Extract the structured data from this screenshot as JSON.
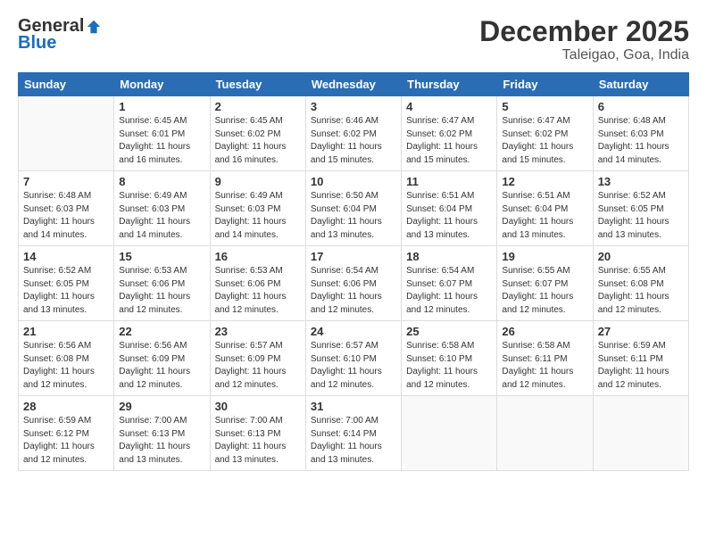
{
  "header": {
    "logo": {
      "general": "General",
      "blue": "Blue"
    },
    "title": "December 2025",
    "location": "Taleigao, Goa, India"
  },
  "weekdays": [
    "Sunday",
    "Monday",
    "Tuesday",
    "Wednesday",
    "Thursday",
    "Friday",
    "Saturday"
  ],
  "weeks": [
    [
      {
        "day": "",
        "info": ""
      },
      {
        "day": "1",
        "info": "Sunrise: 6:45 AM\nSunset: 6:01 PM\nDaylight: 11 hours\nand 16 minutes."
      },
      {
        "day": "2",
        "info": "Sunrise: 6:45 AM\nSunset: 6:02 PM\nDaylight: 11 hours\nand 16 minutes."
      },
      {
        "day": "3",
        "info": "Sunrise: 6:46 AM\nSunset: 6:02 PM\nDaylight: 11 hours\nand 15 minutes."
      },
      {
        "day": "4",
        "info": "Sunrise: 6:47 AM\nSunset: 6:02 PM\nDaylight: 11 hours\nand 15 minutes."
      },
      {
        "day": "5",
        "info": "Sunrise: 6:47 AM\nSunset: 6:02 PM\nDaylight: 11 hours\nand 15 minutes."
      },
      {
        "day": "6",
        "info": "Sunrise: 6:48 AM\nSunset: 6:03 PM\nDaylight: 11 hours\nand 14 minutes."
      }
    ],
    [
      {
        "day": "7",
        "info": "Sunrise: 6:48 AM\nSunset: 6:03 PM\nDaylight: 11 hours\nand 14 minutes."
      },
      {
        "day": "8",
        "info": "Sunrise: 6:49 AM\nSunset: 6:03 PM\nDaylight: 11 hours\nand 14 minutes."
      },
      {
        "day": "9",
        "info": "Sunrise: 6:49 AM\nSunset: 6:03 PM\nDaylight: 11 hours\nand 14 minutes."
      },
      {
        "day": "10",
        "info": "Sunrise: 6:50 AM\nSunset: 6:04 PM\nDaylight: 11 hours\nand 13 minutes."
      },
      {
        "day": "11",
        "info": "Sunrise: 6:51 AM\nSunset: 6:04 PM\nDaylight: 11 hours\nand 13 minutes."
      },
      {
        "day": "12",
        "info": "Sunrise: 6:51 AM\nSunset: 6:04 PM\nDaylight: 11 hours\nand 13 minutes."
      },
      {
        "day": "13",
        "info": "Sunrise: 6:52 AM\nSunset: 6:05 PM\nDaylight: 11 hours\nand 13 minutes."
      }
    ],
    [
      {
        "day": "14",
        "info": "Sunrise: 6:52 AM\nSunset: 6:05 PM\nDaylight: 11 hours\nand 13 minutes."
      },
      {
        "day": "15",
        "info": "Sunrise: 6:53 AM\nSunset: 6:06 PM\nDaylight: 11 hours\nand 12 minutes."
      },
      {
        "day": "16",
        "info": "Sunrise: 6:53 AM\nSunset: 6:06 PM\nDaylight: 11 hours\nand 12 minutes."
      },
      {
        "day": "17",
        "info": "Sunrise: 6:54 AM\nSunset: 6:06 PM\nDaylight: 11 hours\nand 12 minutes."
      },
      {
        "day": "18",
        "info": "Sunrise: 6:54 AM\nSunset: 6:07 PM\nDaylight: 11 hours\nand 12 minutes."
      },
      {
        "day": "19",
        "info": "Sunrise: 6:55 AM\nSunset: 6:07 PM\nDaylight: 11 hours\nand 12 minutes."
      },
      {
        "day": "20",
        "info": "Sunrise: 6:55 AM\nSunset: 6:08 PM\nDaylight: 11 hours\nand 12 minutes."
      }
    ],
    [
      {
        "day": "21",
        "info": "Sunrise: 6:56 AM\nSunset: 6:08 PM\nDaylight: 11 hours\nand 12 minutes."
      },
      {
        "day": "22",
        "info": "Sunrise: 6:56 AM\nSunset: 6:09 PM\nDaylight: 11 hours\nand 12 minutes."
      },
      {
        "day": "23",
        "info": "Sunrise: 6:57 AM\nSunset: 6:09 PM\nDaylight: 11 hours\nand 12 minutes."
      },
      {
        "day": "24",
        "info": "Sunrise: 6:57 AM\nSunset: 6:10 PM\nDaylight: 11 hours\nand 12 minutes."
      },
      {
        "day": "25",
        "info": "Sunrise: 6:58 AM\nSunset: 6:10 PM\nDaylight: 11 hours\nand 12 minutes."
      },
      {
        "day": "26",
        "info": "Sunrise: 6:58 AM\nSunset: 6:11 PM\nDaylight: 11 hours\nand 12 minutes."
      },
      {
        "day": "27",
        "info": "Sunrise: 6:59 AM\nSunset: 6:11 PM\nDaylight: 11 hours\nand 12 minutes."
      }
    ],
    [
      {
        "day": "28",
        "info": "Sunrise: 6:59 AM\nSunset: 6:12 PM\nDaylight: 11 hours\nand 12 minutes."
      },
      {
        "day": "29",
        "info": "Sunrise: 7:00 AM\nSunset: 6:13 PM\nDaylight: 11 hours\nand 13 minutes."
      },
      {
        "day": "30",
        "info": "Sunrise: 7:00 AM\nSunset: 6:13 PM\nDaylight: 11 hours\nand 13 minutes."
      },
      {
        "day": "31",
        "info": "Sunrise: 7:00 AM\nSunset: 6:14 PM\nDaylight: 11 hours\nand 13 minutes."
      },
      {
        "day": "",
        "info": ""
      },
      {
        "day": "",
        "info": ""
      },
      {
        "day": "",
        "info": ""
      }
    ]
  ]
}
